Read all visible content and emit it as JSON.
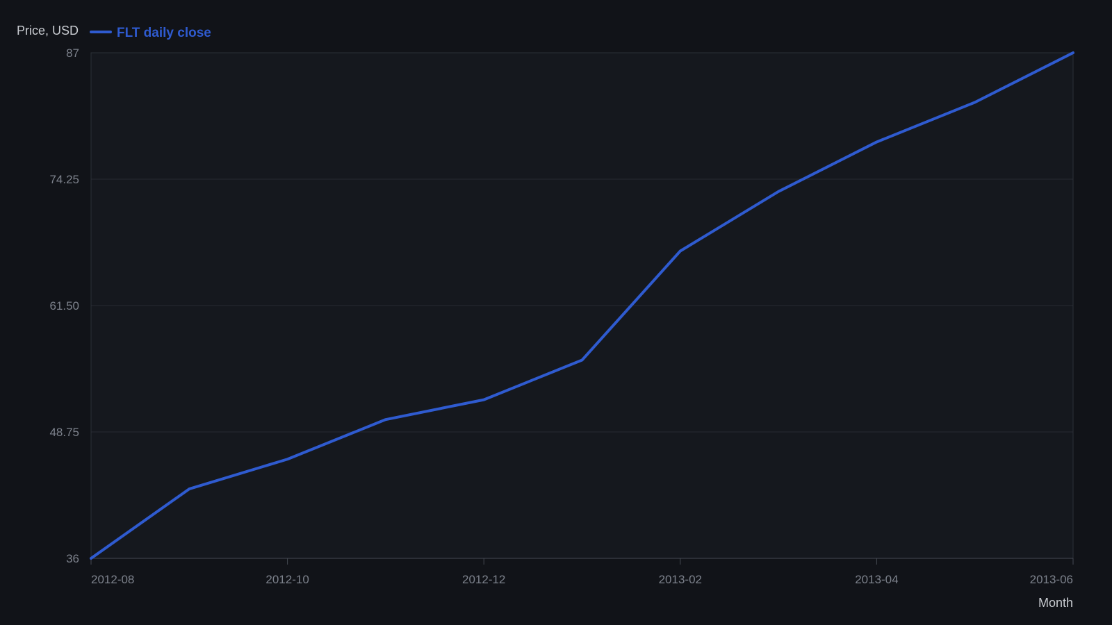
{
  "chart_data": {
    "type": "line",
    "title": "",
    "ylabel": "Price, USD",
    "xlabel": "Month",
    "ylim": [
      36,
      87
    ],
    "yticks": [
      "36",
      "48.75",
      "61.50",
      "74.25",
      "87"
    ],
    "xlim": [
      "2012-08",
      "2013-06"
    ],
    "xticks": [
      "2012-08",
      "2012-10",
      "2012-12",
      "2013-02",
      "2013-04",
      "2013-06"
    ],
    "grid": true,
    "legend": "top-left",
    "categories": [
      "2012-08",
      "2012-09",
      "2012-10",
      "2012-11",
      "2012-12",
      "2013-01",
      "2013-02",
      "2013-03",
      "2013-04",
      "2013-05",
      "2013-06"
    ],
    "series": [
      {
        "name": "FLT daily close",
        "color": "#2f5bd0",
        "values": [
          36.0,
          43.0,
          46.0,
          50.0,
          52.0,
          56.0,
          67.0,
          73.0,
          78.0,
          82.0,
          87.0
        ]
      }
    ]
  }
}
